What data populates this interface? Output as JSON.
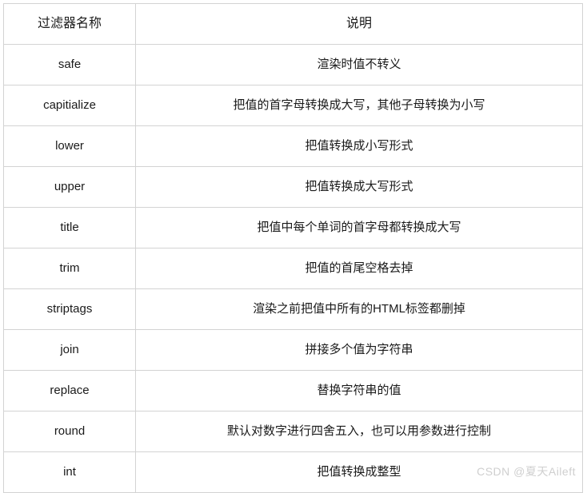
{
  "table": {
    "headers": {
      "name": "过滤器名称",
      "description": "说明"
    },
    "rows": [
      {
        "name": "safe",
        "description": "渲染时值不转义"
      },
      {
        "name": "capitialize",
        "description": "把值的首字母转换成大写，其他子母转换为小写"
      },
      {
        "name": "lower",
        "description": "把值转换成小写形式"
      },
      {
        "name": "upper",
        "description": "把值转换成大写形式"
      },
      {
        "name": "title",
        "description": "把值中每个单词的首字母都转换成大写"
      },
      {
        "name": "trim",
        "description": "把值的首尾空格去掉"
      },
      {
        "name": "striptags",
        "description": "渲染之前把值中所有的HTML标签都删掉"
      },
      {
        "name": "join",
        "description": "拼接多个值为字符串"
      },
      {
        "name": "replace",
        "description": "替换字符串的值"
      },
      {
        "name": "round",
        "description": "默认对数字进行四舍五入，也可以用参数进行控制"
      },
      {
        "name": "int",
        "description": "把值转换成整型"
      }
    ]
  },
  "watermark": {
    "text": "CSDN @夏天Aileft"
  },
  "colors": {
    "border": "#d3d3d3",
    "text": "#1a1a1a",
    "background": "#ffffff",
    "watermark": "#cfcfcf"
  }
}
